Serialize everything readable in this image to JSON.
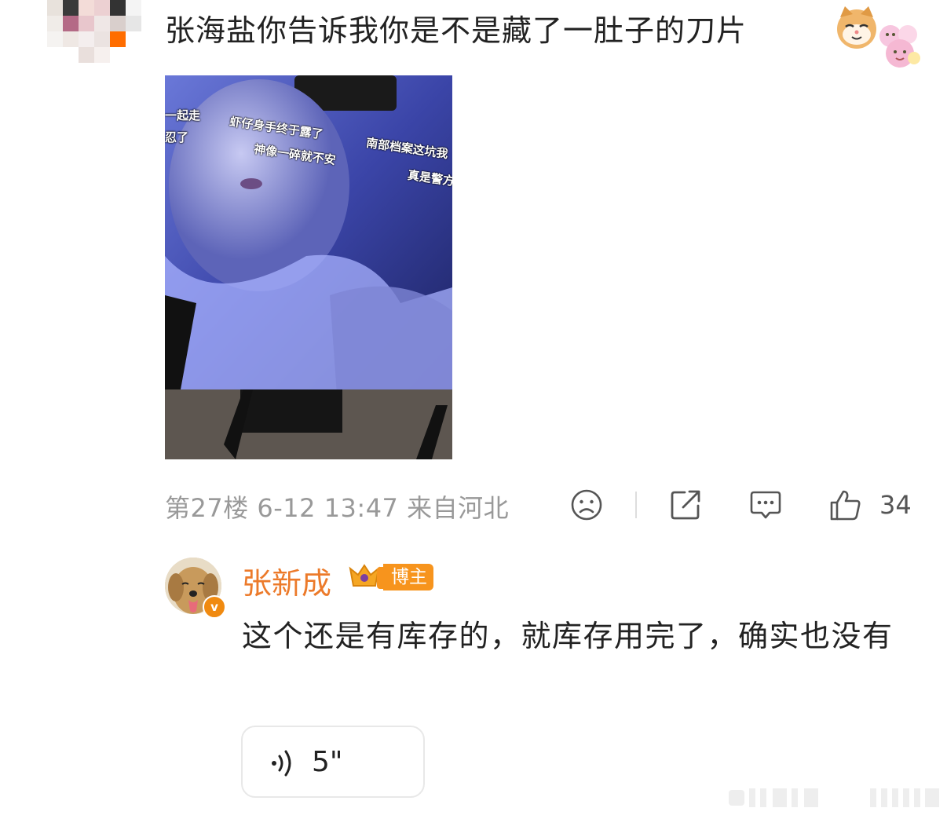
{
  "comment": {
    "text": "张海盐你告诉我你是不是藏了一肚子的刀片",
    "emoji_1": "cat-face-emoji",
    "emoji_2": "cartoon-stickers-emoji",
    "image_overlay_texts": [
      "一起走",
      "忍了",
      "虾仔身手终于露了",
      "神像一碎就不安",
      "南部档案这坑我",
      "真是警方"
    ]
  },
  "meta": {
    "floor_time_location": "第27楼 6-12 13:47 来自河北",
    "like_count": "34"
  },
  "actions": {
    "dislike_icon": "sad-face-icon",
    "share_icon": "share-icon",
    "comment_icon": "comment-bubble-icon",
    "like_icon": "thumbs-up-icon"
  },
  "reply": {
    "author_name": "张新成",
    "role_badge": "博主",
    "text": "这个还是有库存的，就库存用完了，确实也没有",
    "verify_mark": "v",
    "voice_duration": "5\""
  },
  "colors": {
    "author_name": "#ec7a2a",
    "role_badge_bg": "#f7941d",
    "meta_text": "#999999",
    "body_text": "#222222"
  }
}
